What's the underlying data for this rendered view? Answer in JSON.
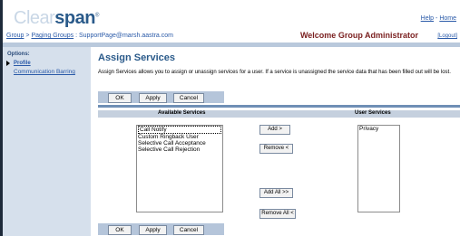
{
  "brand": {
    "part1": "Clear",
    "part2": "span",
    "mark": "®"
  },
  "header": {
    "help_label": "Help",
    "home_label": "Home",
    "separator": " - ",
    "welcome": "Welcome Group Administrator",
    "logout_label": "[Logout]"
  },
  "breadcrumb": {
    "items": [
      "Group",
      "Paging Groups"
    ],
    "sep": " > ",
    "current": "SupportPage@marsh.aastra.com",
    "divider": " : "
  },
  "sidebar": {
    "title": "Options:",
    "items": [
      "Profile",
      "Communication Barring"
    ]
  },
  "page": {
    "title": "Assign Services",
    "description": "Assign Services allows you to assign or unassign services for a user. If a service is unassigned the service data that has been filled out will be lost."
  },
  "buttons": {
    "ok": "OK",
    "apply": "Apply",
    "cancel": "Cancel"
  },
  "columns": {
    "available": "Available Services",
    "user": "User Services"
  },
  "available_services": [
    "Call Notify",
    "Custom Ringback User",
    "Selective Call Acceptance",
    "Selective Call Rejection"
  ],
  "user_services": [
    "Privacy"
  ],
  "move_buttons": {
    "add": "Add >",
    "remove": "Remove <",
    "add_all": "Add All >>",
    "remove_all": "Remove All <"
  }
}
